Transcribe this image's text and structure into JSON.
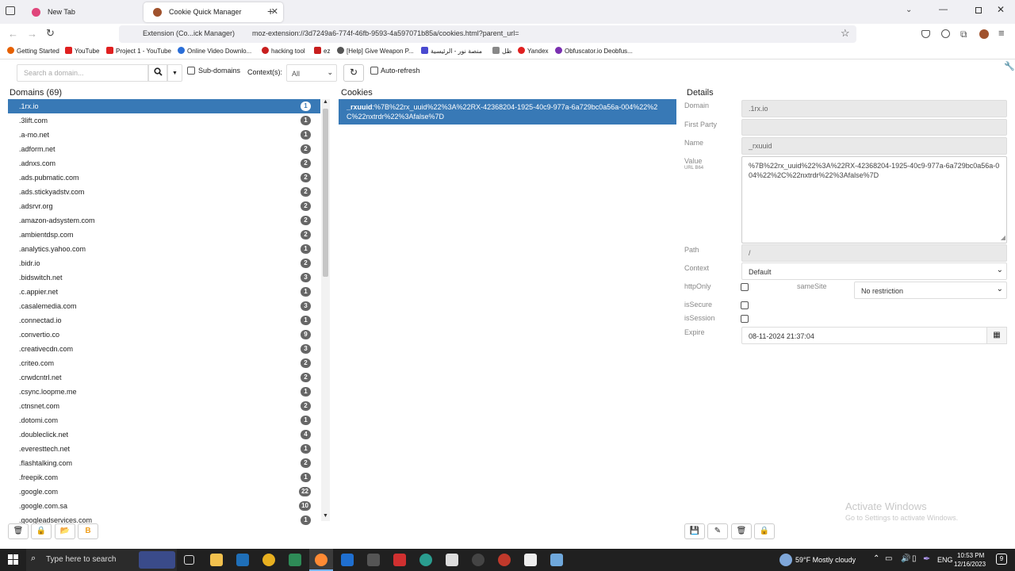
{
  "browser": {
    "tabs": [
      {
        "label": "New Tab",
        "favicon_color": "#e0457b"
      },
      {
        "label": "Cookie Quick Manager",
        "favicon_color": "#a0522d"
      }
    ],
    "url_prefix": "Extension (Co...ick Manager)",
    "url": "moz-extension://3d7249a6-774f-46fb-9593-4a597071b85a/cookies.html?parent_url=",
    "bookmarks": [
      {
        "label": "Getting Started",
        "color": "#e66000"
      },
      {
        "label": "YouTube",
        "color": "#e02020"
      },
      {
        "label": "Project 1 - YouTube",
        "color": "#e02020"
      },
      {
        "label": "Online Video Downlo...",
        "color": "#2a6ed8"
      },
      {
        "label": "hacking tool",
        "color": "#c81e1e"
      },
      {
        "label": "ez",
        "color": "#c81e1e"
      },
      {
        "label": "[Help] Give Weapon P...",
        "color": "#555555"
      },
      {
        "label": "منصة نور - الرئيسية",
        "color": "#4a4ad0"
      },
      {
        "label": "ظل",
        "color": "#888888"
      },
      {
        "label": "Yandex",
        "color": "#e02020"
      },
      {
        "label": "Obfuscator.io Deobfus...",
        "color": "#7a2fb0"
      }
    ]
  },
  "toolbar": {
    "search_placeholder": "Search a domain...",
    "subdomains_label": "Sub-domains",
    "contexts_label": "Context(s):",
    "contexts_value": "All",
    "autorefresh_label": "Auto-refresh"
  },
  "domains": {
    "header": "Domains (69)",
    "items": [
      {
        "name": ".1rx.io",
        "count": "1"
      },
      {
        "name": ".3lift.com",
        "count": "1"
      },
      {
        "name": ".a-mo.net",
        "count": "1"
      },
      {
        "name": ".adform.net",
        "count": "2"
      },
      {
        "name": ".adnxs.com",
        "count": "2"
      },
      {
        "name": ".ads.pubmatic.com",
        "count": "2"
      },
      {
        "name": ".ads.stickyadstv.com",
        "count": "2"
      },
      {
        "name": ".adsrvr.org",
        "count": "2"
      },
      {
        "name": ".amazon-adsystem.com",
        "count": "2"
      },
      {
        "name": ".ambientdsp.com",
        "count": "2"
      },
      {
        "name": ".analytics.yahoo.com",
        "count": "1"
      },
      {
        "name": ".bidr.io",
        "count": "2"
      },
      {
        "name": ".bidswitch.net",
        "count": "3"
      },
      {
        "name": ".c.appier.net",
        "count": "1"
      },
      {
        "name": ".casalemedia.com",
        "count": "3"
      },
      {
        "name": ".connectad.io",
        "count": "1"
      },
      {
        "name": ".convertio.co",
        "count": "9"
      },
      {
        "name": ".creativecdn.com",
        "count": "3"
      },
      {
        "name": ".criteo.com",
        "count": "2"
      },
      {
        "name": ".crwdcntrl.net",
        "count": "2"
      },
      {
        "name": ".csync.loopme.me",
        "count": "1"
      },
      {
        "name": ".ctnsnet.com",
        "count": "2"
      },
      {
        "name": ".dotomi.com",
        "count": "1"
      },
      {
        "name": ".doubleclick.net",
        "count": "4"
      },
      {
        "name": ".everesttech.net",
        "count": "1"
      },
      {
        "name": ".flashtalking.com",
        "count": "2"
      },
      {
        "name": ".freepik.com",
        "count": "1"
      },
      {
        "name": ".google.com",
        "count": "22"
      },
      {
        "name": ".google.com.sa",
        "count": "10"
      },
      {
        "name": ".googleadservices.com",
        "count": "1"
      }
    ]
  },
  "cookies": {
    "header": "Cookies",
    "items": [
      {
        "name": "_rxuuid",
        "value": ":%7B%22rx_uuid%22%3A%22RX-42368204-1925-40c9-977a-6a729bc0a56a-004%22%2C%22nxtrdr%22%3Afalse%7D"
      }
    ]
  },
  "details": {
    "header": "Details",
    "domain_label": "Domain",
    "domain_value": ".1rx.io",
    "firstparty_label": "First Party",
    "name_label": "Name",
    "name_value": "_rxuuid",
    "value_label": "Value",
    "value_sub": "URL B64",
    "value_value": "%7B%22rx_uuid%22%3A%22RX-42368204-1925-40c9-977a-6a729bc0a56a-004%22%2C%22nxtrdr%22%3Afalse%7D",
    "path_label": "Path",
    "path_value": "/",
    "context_label": "Context",
    "context_value": "Default",
    "httponly_label": "httpOnly",
    "samesite_label": "sameSite",
    "samesite_value": "No restriction",
    "issecure_label": "isSecure",
    "issession_label": "isSession",
    "expire_label": "Expire",
    "expire_value": "08-11-2024 21:37:04"
  },
  "watermark": {
    "title": "Activate Windows",
    "subtitle": "Go to Settings to activate Windows."
  },
  "taskbar": {
    "search_placeholder": "Type here to search",
    "weather": "59°F  Mostly cloudy",
    "lang": "ENG",
    "time": "10:53 PM",
    "date": "12/16/2023"
  }
}
